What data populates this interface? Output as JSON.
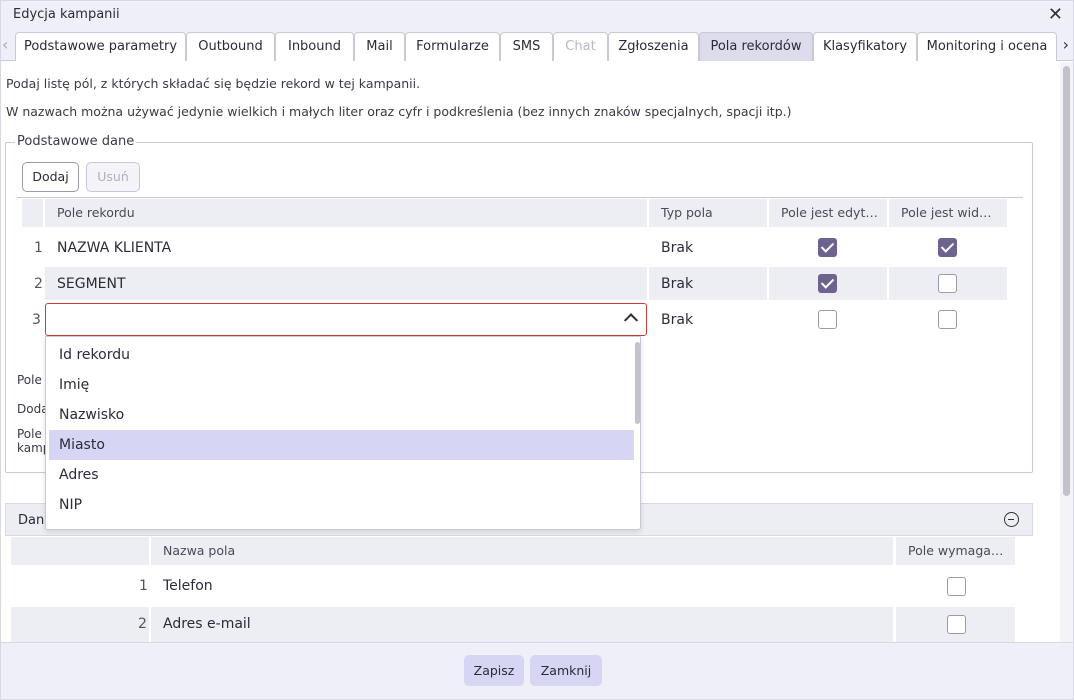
{
  "window": {
    "title": "Edycja kampanii",
    "close_icon": "close-icon"
  },
  "tabs": [
    {
      "label": "Podstawowe parametry"
    },
    {
      "label": "Outbound"
    },
    {
      "label": "Inbound"
    },
    {
      "label": "Mail"
    },
    {
      "label": "Formularze"
    },
    {
      "label": "SMS"
    },
    {
      "label": "Chat",
      "disabled": true
    },
    {
      "label": "Zgłoszenia"
    },
    {
      "label": "Pola rekordów",
      "active": true
    },
    {
      "label": "Klasyfikatory"
    },
    {
      "label": "Monitoring i ocena"
    }
  ],
  "description": {
    "line1": "Podaj listę pól, z których składać się będzie rekord w tej kampanii.",
    "line2": "W nazwach można używać jedynie wielkich i małych liter oraz cyfr i podkreślenia (bez innych znaków specjalnych, spacji itp.)"
  },
  "basic_group": {
    "legend": "Podstawowe dane",
    "add_label": "Dodaj",
    "remove_label": "Usuń",
    "columns": [
      "Pole rekordu",
      "Typ pola",
      "Pole jest edyt…",
      "Pole jest wid…"
    ],
    "rows": [
      {
        "num": "1",
        "field": "NAZWA KLIENTA",
        "type": "Brak",
        "editable": true,
        "visible": true
      },
      {
        "num": "2",
        "field": "SEGMENT",
        "type": "Brak",
        "editable": true,
        "visible": false
      },
      {
        "num": "3",
        "field": "",
        "type": "Brak",
        "editable": false,
        "visible": false
      }
    ],
    "hidden_texts": [
      "Pole",
      "Doda",
      "Pole",
      "kamp"
    ]
  },
  "dropdown": {
    "options": [
      "Id rekordu",
      "Imię",
      "Nazwisko",
      "Miasto",
      "Adres",
      "NIP"
    ],
    "highlighted_index": 3
  },
  "contact_panel": {
    "title": "Dane",
    "collapse_icon": "minus-circle-icon",
    "columns": [
      "Nazwa pola",
      "Pole wymaga…"
    ],
    "rows": [
      {
        "num": "1",
        "name": "Telefon",
        "required": false
      },
      {
        "num": "2",
        "name": "Adres e-mail",
        "required": false
      }
    ]
  },
  "footer": {
    "save_label": "Zapisz",
    "close_label": "Zamknij"
  },
  "colors": {
    "accent": "#6e628e",
    "error_border": "#cc3b3b",
    "highlight": "#d6d6f4"
  }
}
